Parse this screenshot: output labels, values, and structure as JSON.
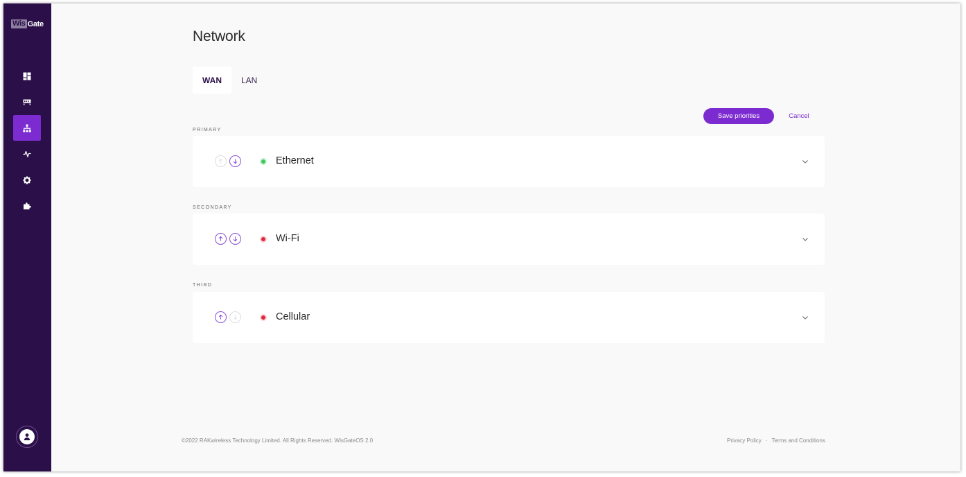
{
  "app": {
    "logo_prefix": "Wis",
    "logo_suffix": "Gate"
  },
  "sidebar": {
    "items": [
      {
        "icon": "dashboard-icon",
        "active": false
      },
      {
        "icon": "gateway-icon",
        "active": false
      },
      {
        "icon": "network-icon",
        "active": true
      },
      {
        "icon": "activity-icon",
        "active": false
      },
      {
        "icon": "settings-icon",
        "active": false
      },
      {
        "icon": "extensions-icon",
        "active": false
      }
    ],
    "profile_icon": "user-icon"
  },
  "page": {
    "title": "Network"
  },
  "tabs": [
    {
      "label": "WAN",
      "active": true
    },
    {
      "label": "LAN",
      "active": false
    }
  ],
  "actions": {
    "save_label": "Save priorities",
    "cancel_label": "Cancel"
  },
  "interfaces": [
    {
      "section": "PRIMARY",
      "name": "Ethernet",
      "status": "connected",
      "status_color": "#3ec95c",
      "up_enabled": false,
      "down_enabled": true
    },
    {
      "section": "SECONDARY",
      "name": "Wi-Fi",
      "status": "disconnected",
      "status_color": "#e0283c",
      "up_enabled": true,
      "down_enabled": true
    },
    {
      "section": "THIRD",
      "name": "Cellular",
      "status": "disconnected",
      "status_color": "#e0283c",
      "up_enabled": true,
      "down_enabled": false
    }
  ],
  "footer": {
    "copyright": "©2022 RAKwireless Technology Limited. All Rights Reserved. WisGateOS 2.0",
    "privacy": "Privacy Policy",
    "separator": "·",
    "terms": "Terms and Conditions"
  },
  "colors": {
    "sidebar": "#2b0f48",
    "accent": "#7b2bd0",
    "background": "#f9f9f9"
  }
}
